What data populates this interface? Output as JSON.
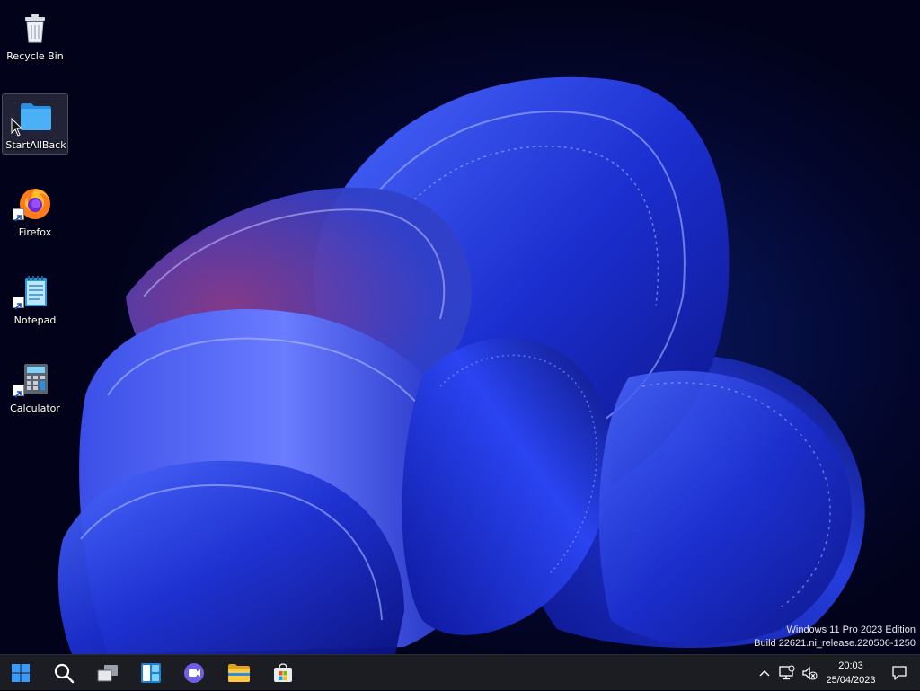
{
  "desktop": {
    "icons": [
      {
        "label": "Recycle Bin",
        "icon": "recycle-bin-icon",
        "shortcut": false,
        "selected": false
      },
      {
        "label": "StartAllBack",
        "icon": "folder-icon",
        "shortcut": false,
        "selected": true
      },
      {
        "label": "Firefox",
        "icon": "firefox-icon",
        "shortcut": true,
        "selected": false
      },
      {
        "label": "Notepad",
        "icon": "notepad-icon",
        "shortcut": true,
        "selected": false
      },
      {
        "label": "Calculator",
        "icon": "calculator-icon",
        "shortcut": true,
        "selected": false
      }
    ],
    "watermark": {
      "line1": "Windows 11 Pro 2023 Edition",
      "line2": "Build 22621.ni_release.220506-1250"
    }
  },
  "taskbar": {
    "pinned": [
      "start-icon",
      "search-icon",
      "task-view-icon",
      "widgets-icon",
      "chat-icon",
      "file-explorer-icon",
      "microsoft-store-icon"
    ],
    "tray": [
      "chevron-up-icon",
      "network-icon",
      "volume-muted-icon",
      "notification-icon"
    ],
    "clock": {
      "time": "20:03",
      "date": "25/04/2023"
    }
  },
  "colors": {
    "taskbar_bg": "#1c1d22",
    "wallpaper_blue": "#1a35d8",
    "start_blue": "#3a9bff"
  }
}
